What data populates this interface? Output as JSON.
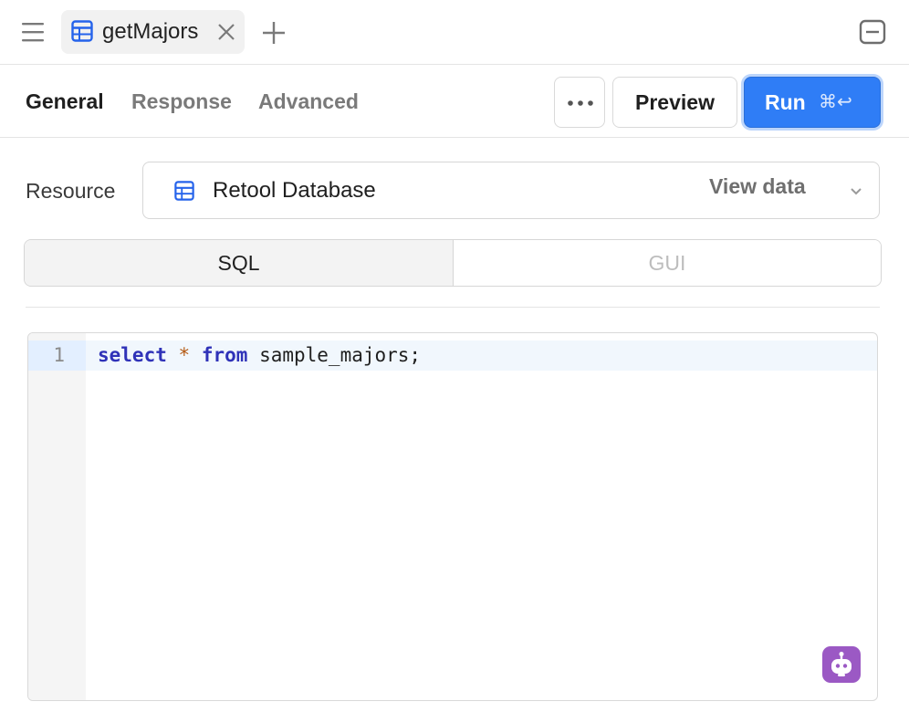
{
  "tabbar": {
    "tab_title": "getMajors"
  },
  "subtabs": {
    "general": "General",
    "response": "Response",
    "advanced": "Advanced"
  },
  "actions": {
    "preview_label": "Preview",
    "run_label": "Run",
    "run_shortcut": "⌘↩"
  },
  "resource": {
    "label": "Resource",
    "name": "Retool Database",
    "view_data": "View data"
  },
  "mode_toggle": {
    "sql": "SQL",
    "gui": "GUI",
    "selected": "SQL"
  },
  "editor": {
    "line_number": "1",
    "tokens": {
      "kw_select": "select",
      "op_star": "*",
      "kw_from": "from",
      "rest": "sample_majors;"
    }
  },
  "colors": {
    "accent": "#2f7df6",
    "keyword": "#2f32b8",
    "operator": "#b45a14",
    "assistant": "#9b59c4"
  }
}
